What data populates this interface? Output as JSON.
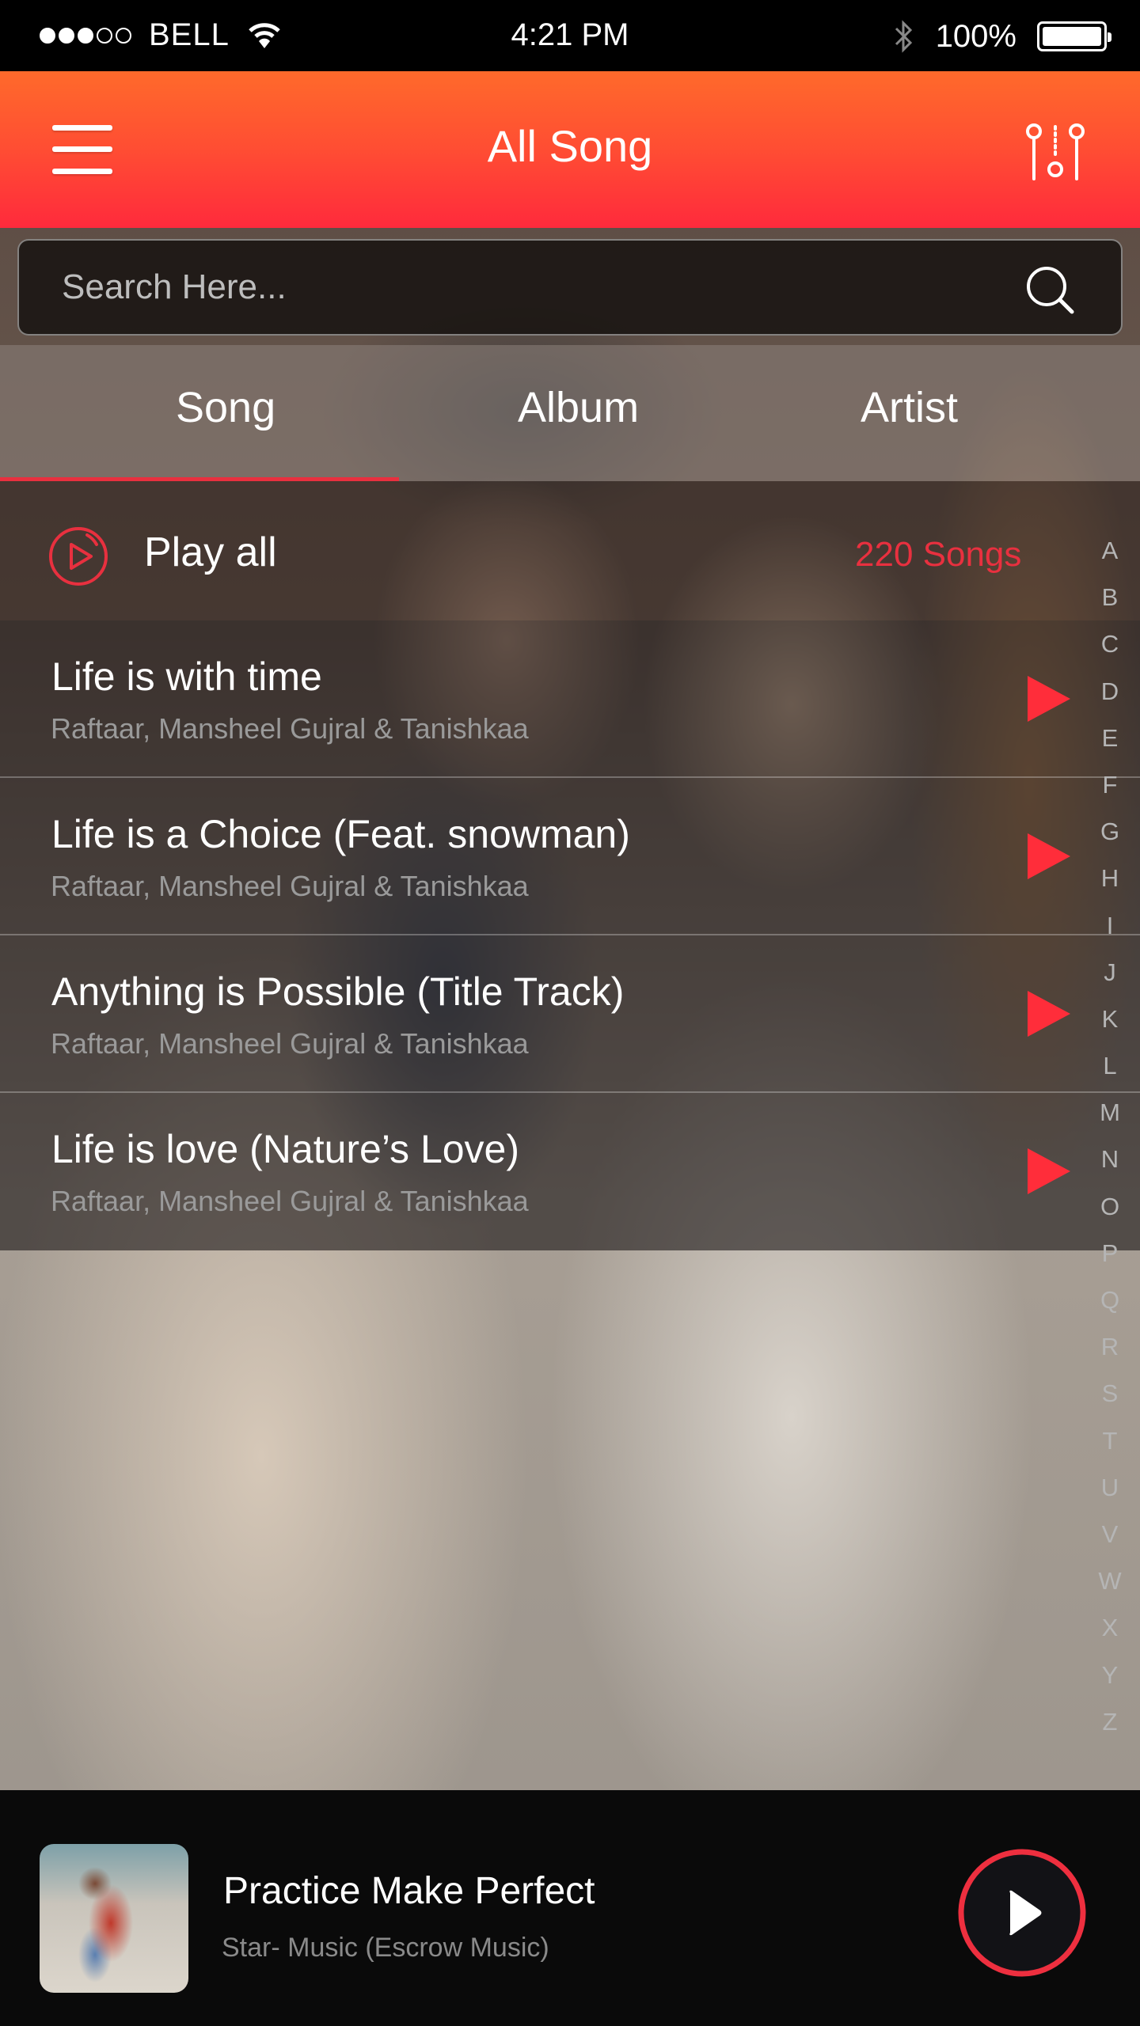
{
  "status_bar": {
    "signal_bars_filled": 3,
    "signal_bars_total": 5,
    "carrier": "BELL",
    "time": "4:21 PM",
    "battery": "100%"
  },
  "header": {
    "title": "All Song",
    "menu_icon": "hamburger-menu-icon",
    "filter_icon": "equalizer-filter-icon"
  },
  "search": {
    "placeholder": "Search Here...",
    "value": "",
    "icon": "search-icon"
  },
  "tabs": [
    {
      "label": "Song",
      "active": true
    },
    {
      "label": "Album",
      "active": false
    },
    {
      "label": "Artist",
      "active": false
    }
  ],
  "play_all": {
    "label": "Play all",
    "count": "220 Songs",
    "icon": "play-circle-icon"
  },
  "songs": [
    {
      "title": "Life is with time",
      "artist": "Raftaar, Mansheel Gujral & Tanishkaa"
    },
    {
      "title": "Life is a Choice (Feat. snowman)",
      "artist": "Raftaar, Mansheel Gujral & Tanishkaa"
    },
    {
      "title": "Anything is Possible (Title Track)",
      "artist": "Raftaar, Mansheel Gujral & Tanishkaa"
    },
    {
      "title": "Life is love (Nature’s Love)",
      "artist": "Raftaar, Mansheel Gujral & Tanishkaa"
    }
  ],
  "alphabet": [
    "A",
    "B",
    "C",
    "D",
    "E",
    "F",
    "G",
    "H",
    "I",
    "J",
    "K",
    "L",
    "M",
    "N",
    "O",
    "P",
    "Q",
    "R",
    "S",
    "T",
    "U",
    "V",
    "W",
    "X",
    "Y",
    "Z"
  ],
  "now_playing": {
    "title": "Practice Make Perfect",
    "subtitle": "Star- Music (Escrow Music)",
    "state": "paused"
  },
  "colors": {
    "accent": "#e8303f",
    "header_top": "#ff6a2b",
    "header_bottom": "#ff2a3c",
    "play_triangle": "#ff2d3a"
  }
}
